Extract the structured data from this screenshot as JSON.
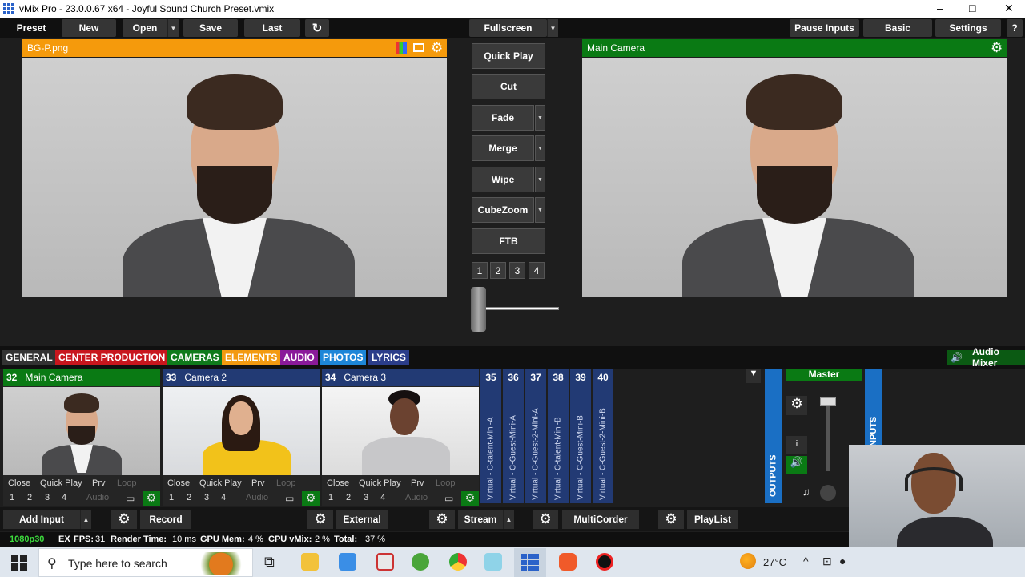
{
  "window": {
    "title": "vMix Pro - 23.0.0.67 x64 - Joyful Sound Church Preset.vmix",
    "minimize": "–",
    "maximize": "□",
    "close": "✕"
  },
  "menu": {
    "preset": "Preset",
    "new": "New",
    "open": "Open",
    "save": "Save",
    "last": "Last",
    "fullscreen": "Fullscreen",
    "pause_inputs": "Pause Inputs",
    "basic": "Basic",
    "settings": "Settings",
    "help": "?"
  },
  "preview": {
    "title": "BG-P.png",
    "color": "#f59a0c"
  },
  "output": {
    "title": "Main Camera",
    "color": "#0a7a14"
  },
  "transitions": {
    "quick_play": "Quick Play",
    "cut": "Cut",
    "fade": "Fade",
    "merge": "Merge",
    "wipe": "Wipe",
    "cubezoom": "CubeZoom",
    "ftb": "FTB",
    "numbers": [
      "1",
      "2",
      "3",
      "4"
    ],
    "tbar_level": 0.05
  },
  "tabs": [
    {
      "label": "GENERAL",
      "color": "#333333"
    },
    {
      "label": "CENTER PRODUCTION",
      "color": "#c8161d"
    },
    {
      "label": "CAMERAS",
      "color": "#0f7a1b"
    },
    {
      "label": "ELEMENTS",
      "color": "#f39a10"
    },
    {
      "label": "AUDIO",
      "color": "#8a1a9a"
    },
    {
      "label": "PHOTOS",
      "color": "#1d86d8"
    },
    {
      "label": "LYRICS",
      "color": "#2b3d8a"
    }
  ],
  "audio_mixer": {
    "label": "Audio Mixer",
    "master": "Master",
    "outputs": "OUTPUTS",
    "inputs": "INPUTS",
    "info": "i"
  },
  "inputs": [
    {
      "number": "32",
      "name": "Main Camera",
      "color": "#0a7a14"
    },
    {
      "number": "33",
      "name": "Camera 2",
      "color": "#223a74"
    },
    {
      "number": "34",
      "name": "Camera 3",
      "color": "#223a74"
    }
  ],
  "input_controls": {
    "close": "Close",
    "quick_play": "Quick Play",
    "prv": "Prv",
    "loop": "Loop",
    "n1": "1",
    "n2": "2",
    "n3": "3",
    "n4": "4",
    "audio": "Audio"
  },
  "virtual_inputs": [
    {
      "number": "35",
      "name": "Virtual - C-talent-Mini-A"
    },
    {
      "number": "36",
      "name": "Virtual - C-Guest-Mini-A"
    },
    {
      "number": "37",
      "name": "Virtual - C-Guest-2-Mini-A"
    },
    {
      "number": "38",
      "name": "Virtual - C-talent-Mini-B"
    },
    {
      "number": "39",
      "name": "Virtual - C-Guest-Mini-B"
    },
    {
      "number": "40",
      "name": "Virtual - C-Guest-2-Mini-B"
    }
  ],
  "bottom_bar": {
    "add_input": "Add Input",
    "record": "Record",
    "external": "External",
    "stream": "Stream",
    "multicorder": "MultiCorder",
    "playlist": "PlayList"
  },
  "status": {
    "format": "1080p30",
    "ex": "EX",
    "fps_label": "FPS:",
    "fps": "31",
    "render_label": "Render Time:",
    "render": "10 ms",
    "gpu_label": "GPU Mem:",
    "gpu": "4 %",
    "cpu_label": "CPU vMix:",
    "cpu": "2 %",
    "total_label": "Total:",
    "total": "37 %"
  },
  "taskbar": {
    "search_placeholder": "Type here to search",
    "temperature": "27°C"
  }
}
